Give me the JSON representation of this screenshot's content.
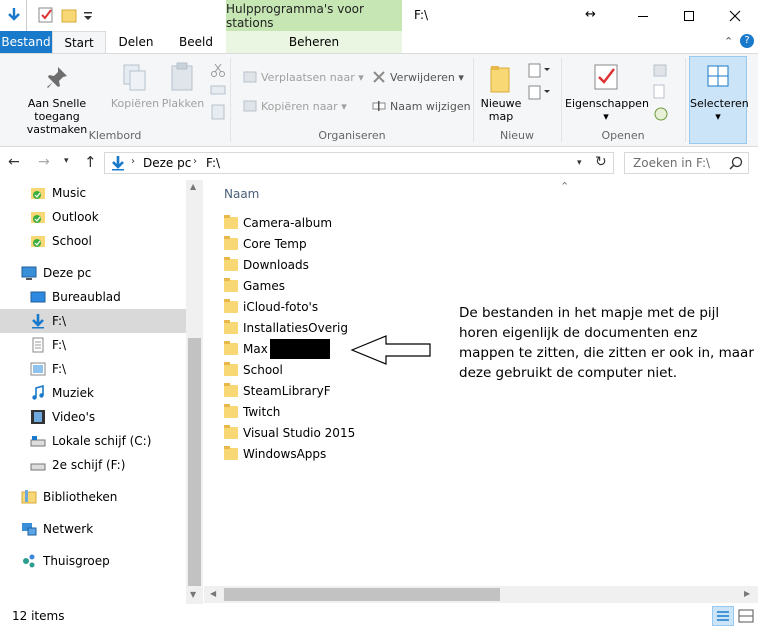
{
  "titlebar": {
    "context_tab": "Hulpprogramma's voor stations",
    "window_title": "F:\\"
  },
  "tabs": {
    "file": "Bestand",
    "start": "Start",
    "share": "Delen",
    "view": "Beeld",
    "manage": "Beheren"
  },
  "ribbon": {
    "pin_label": "Aan Snelle toegang vastmaken",
    "copy_label": "Kopiëren",
    "paste_label": "Plakken",
    "clipboard_group": "Klembord",
    "move_to": "Verplaatsen naar",
    "copy_to": "Kopiëren naar",
    "delete": "Verwijderen",
    "rename": "Naam wijzigen",
    "organize_group": "Organiseren",
    "new_folder": "Nieuwe map",
    "new_group": "Nieuw",
    "properties": "Eigenschappen",
    "open_group": "Openen",
    "select": "Selecteren"
  },
  "address": {
    "crumb_pc": "Deze pc",
    "crumb_drive": "F:\\",
    "search_placeholder": "Zoeken in F:\\"
  },
  "nav": {
    "items": [
      {
        "label": "Music",
        "icon": "folder-sync-icon"
      },
      {
        "label": "Outlook",
        "icon": "folder-sync-icon"
      },
      {
        "label": "School",
        "icon": "folder-sync-icon"
      },
      {
        "label": "Deze pc",
        "icon": "computer-icon"
      },
      {
        "label": "Bureaublad",
        "icon": "desktop-icon"
      },
      {
        "label": "F:\\",
        "icon": "downloads-icon"
      },
      {
        "label": "F:\\",
        "icon": "documents-icon"
      },
      {
        "label": "F:\\",
        "icon": "pictures-icon"
      },
      {
        "label": "Muziek",
        "icon": "music-icon"
      },
      {
        "label": "Video's",
        "icon": "video-icon"
      },
      {
        "label": "Lokale schijf (C:)",
        "icon": "drive-icon"
      },
      {
        "label": "2e schijf (F:)",
        "icon": "drive-icon"
      },
      {
        "label": "Bibliotheken",
        "icon": "libraries-icon"
      },
      {
        "label": "Netwerk",
        "icon": "network-icon"
      },
      {
        "label": "Thuisgroep",
        "icon": "homegroup-icon"
      }
    ]
  },
  "filelist": {
    "column_name": "Naam",
    "files": [
      "Camera-album",
      "Core Temp",
      "Downloads",
      "Games",
      "iCloud-foto's",
      "InstallatiesOverig",
      "Max",
      "School",
      "SteamLibraryF",
      "Twitch",
      "Visual Studio 2015",
      "WindowsApps"
    ]
  },
  "annotation": {
    "text": "De bestanden in het mapje met de pijl horen eigenlijk de documenten enz mappen te zitten, die zitten er ook in, maar deze gebruikt de computer niet."
  },
  "status": {
    "item_count": "12 items"
  },
  "colors": {
    "accent": "#1979ca",
    "context_tab": "#c6e6b4",
    "selected_nav": "#d9d9d9",
    "folder": "#f8d775"
  }
}
